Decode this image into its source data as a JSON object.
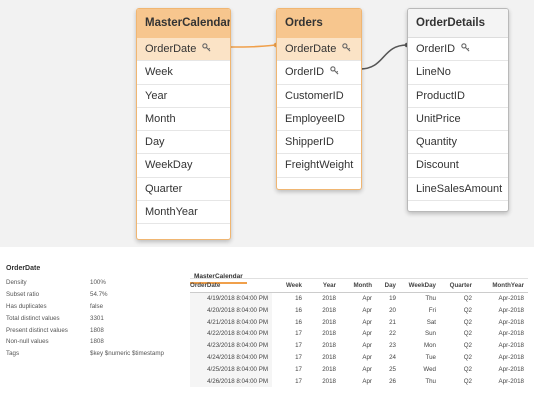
{
  "model_viewer": {
    "tables": [
      {
        "name": "MasterCalendar",
        "selected": true,
        "fields": [
          {
            "label": "OrderDate",
            "key": true,
            "highlight": true
          },
          {
            "label": "Week",
            "key": false
          },
          {
            "label": "Year",
            "key": false
          },
          {
            "label": "Month",
            "key": false
          },
          {
            "label": "Day",
            "key": false
          },
          {
            "label": "WeekDay",
            "key": false
          },
          {
            "label": "Quarter",
            "key": false
          },
          {
            "label": "MonthYear",
            "key": false
          }
        ]
      },
      {
        "name": "Orders",
        "selected": true,
        "fields": [
          {
            "label": "OrderDate",
            "key": true,
            "highlight": true
          },
          {
            "label": "OrderID",
            "key": true
          },
          {
            "label": "CustomerID",
            "key": false
          },
          {
            "label": "EmployeeID",
            "key": false
          },
          {
            "label": "ShipperID",
            "key": false
          },
          {
            "label": "FreightWeight",
            "key": false
          }
        ]
      },
      {
        "name": "OrderDetails",
        "selected": false,
        "fields": [
          {
            "label": "OrderID",
            "key": true
          },
          {
            "label": "LineNo",
            "key": false
          },
          {
            "label": "ProductID",
            "key": false
          },
          {
            "label": "UnitPrice",
            "key": false
          },
          {
            "label": "Quantity",
            "key": false
          },
          {
            "label": "Discount",
            "key": false
          },
          {
            "label": "LineSalesAmount",
            "key": false
          }
        ]
      }
    ],
    "colors": {
      "selected_header": "#f7c68e",
      "link_selected": "#f0a04b",
      "link_plain": "#555555"
    }
  },
  "preview": {
    "metadata_title": "OrderDate",
    "metadata": [
      {
        "label": "Density",
        "value": "100%"
      },
      {
        "label": "Subset ratio",
        "value": "54.7%"
      },
      {
        "label": "Has duplicates",
        "value": "false"
      },
      {
        "label": "Total distinct values",
        "value": "3301"
      },
      {
        "label": "Present distinct values",
        "value": "1808"
      },
      {
        "label": "Non-null values",
        "value": "1808"
      },
      {
        "label": "Tags",
        "value": "$key $numeric $timestamp"
      }
    ],
    "tab_label": "MasterCalendar",
    "columns": [
      "OrderDate",
      "Week",
      "Year",
      "Month",
      "Day",
      "WeekDay",
      "Quarter",
      "MonthYear"
    ],
    "rows": [
      [
        "4/19/2018 8:04:00 PM",
        "16",
        "2018",
        "Apr",
        "19",
        "Thu",
        "Q2",
        "Apr-2018"
      ],
      [
        "4/20/2018 8:04:00 PM",
        "16",
        "2018",
        "Apr",
        "20",
        "Fri",
        "Q2",
        "Apr-2018"
      ],
      [
        "4/21/2018 8:04:00 PM",
        "16",
        "2018",
        "Apr",
        "21",
        "Sat",
        "Q2",
        "Apr-2018"
      ],
      [
        "4/22/2018 8:04:00 PM",
        "17",
        "2018",
        "Apr",
        "22",
        "Sun",
        "Q2",
        "Apr-2018"
      ],
      [
        "4/23/2018 8:04:00 PM",
        "17",
        "2018",
        "Apr",
        "23",
        "Mon",
        "Q2",
        "Apr-2018"
      ],
      [
        "4/24/2018 8:04:00 PM",
        "17",
        "2018",
        "Apr",
        "24",
        "Tue",
        "Q2",
        "Apr-2018"
      ],
      [
        "4/25/2018 8:04:00 PM",
        "17",
        "2018",
        "Apr",
        "25",
        "Wed",
        "Q2",
        "Apr-2018"
      ],
      [
        "4/26/2018 8:04:00 PM",
        "17",
        "2018",
        "Apr",
        "26",
        "Thu",
        "Q2",
        "Apr-2018"
      ]
    ]
  }
}
